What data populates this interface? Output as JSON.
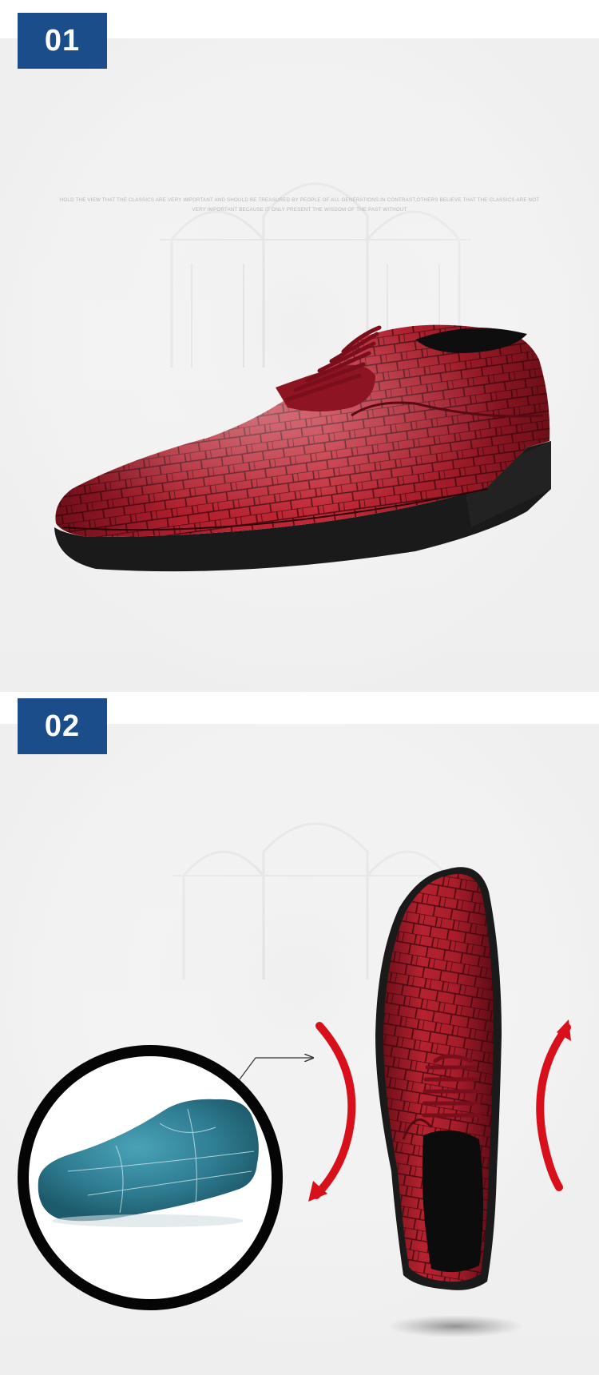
{
  "sections": [
    {
      "number": "01",
      "tagline": "HOLD THE VIEW THAT THE CLASSICS ARE VERY IMPORTANT AND SHOULD BE TREASURED BY PEOPLE OF ALL GENERATIONS.IN CONTRAST,OTHERS BELIEVE THAT THE CLASSICS ARE NOT VERY IMPORTANT BECAUSE IT ONLY PRESENT THE WISDOM OF THE PAST WITHOUT"
    },
    {
      "number": "02"
    }
  ],
  "colors": {
    "badge": "#1b4d8b",
    "leather": "#9e1a28",
    "shoe_last": "#2f7d92",
    "arrows": "#d8101c"
  }
}
